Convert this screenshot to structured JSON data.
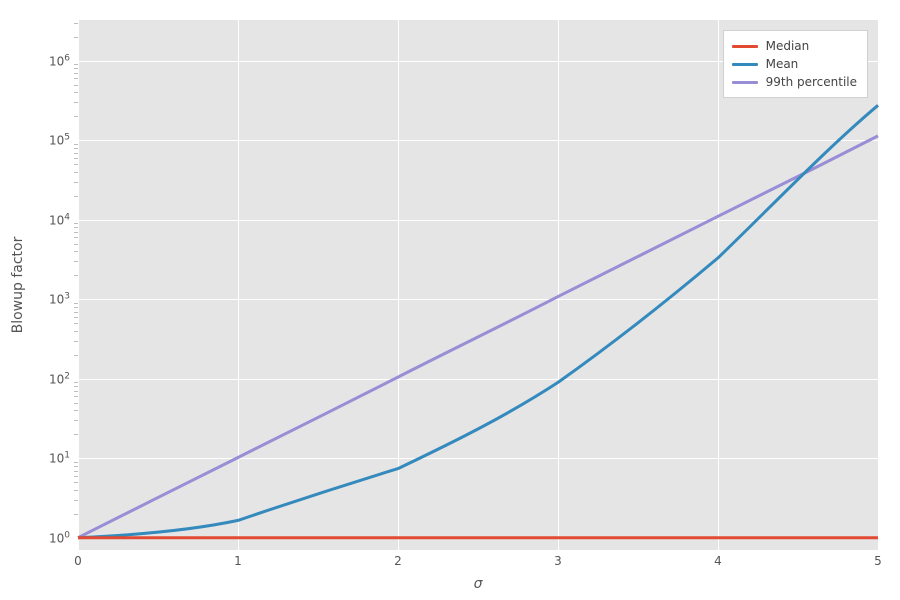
{
  "chart_data": {
    "type": "line",
    "xlabel": "σ",
    "ylabel": "Blowup factor",
    "xlim": [
      0,
      5
    ],
    "yscale": "log",
    "ylim": [
      0.7,
      3000000
    ],
    "x": [
      0,
      1,
      2,
      3,
      4,
      5
    ],
    "x_ticks": [
      0,
      1,
      2,
      3,
      4,
      5
    ],
    "y_ticks": [
      1,
      10,
      100,
      1000,
      10000,
      100000,
      1000000
    ],
    "y_tick_labels": [
      "10^0",
      "10^1",
      "10^2",
      "10^3",
      "10^4",
      "10^5",
      "10^6"
    ],
    "legend_position": "upper right",
    "grid": true,
    "series": [
      {
        "name": "Median",
        "color": "#e24a33",
        "values": [
          1,
          1,
          1,
          1,
          1,
          1
        ]
      },
      {
        "name": "Mean",
        "color": "#348abd",
        "values": [
          1,
          1.65,
          7.4,
          90,
          3300,
          270000
        ]
      },
      {
        "name": "99th percentile",
        "color": "#988ed5",
        "values": [
          1,
          10.2,
          105,
          1080,
          11000,
          113000
        ]
      }
    ]
  },
  "legend": {
    "items": [
      {
        "label": "Median"
      },
      {
        "label": "Mean"
      },
      {
        "label": "99th percentile"
      }
    ]
  },
  "colors": {
    "median": "#e24a33",
    "mean": "#348abd",
    "p99": "#988ed5"
  }
}
